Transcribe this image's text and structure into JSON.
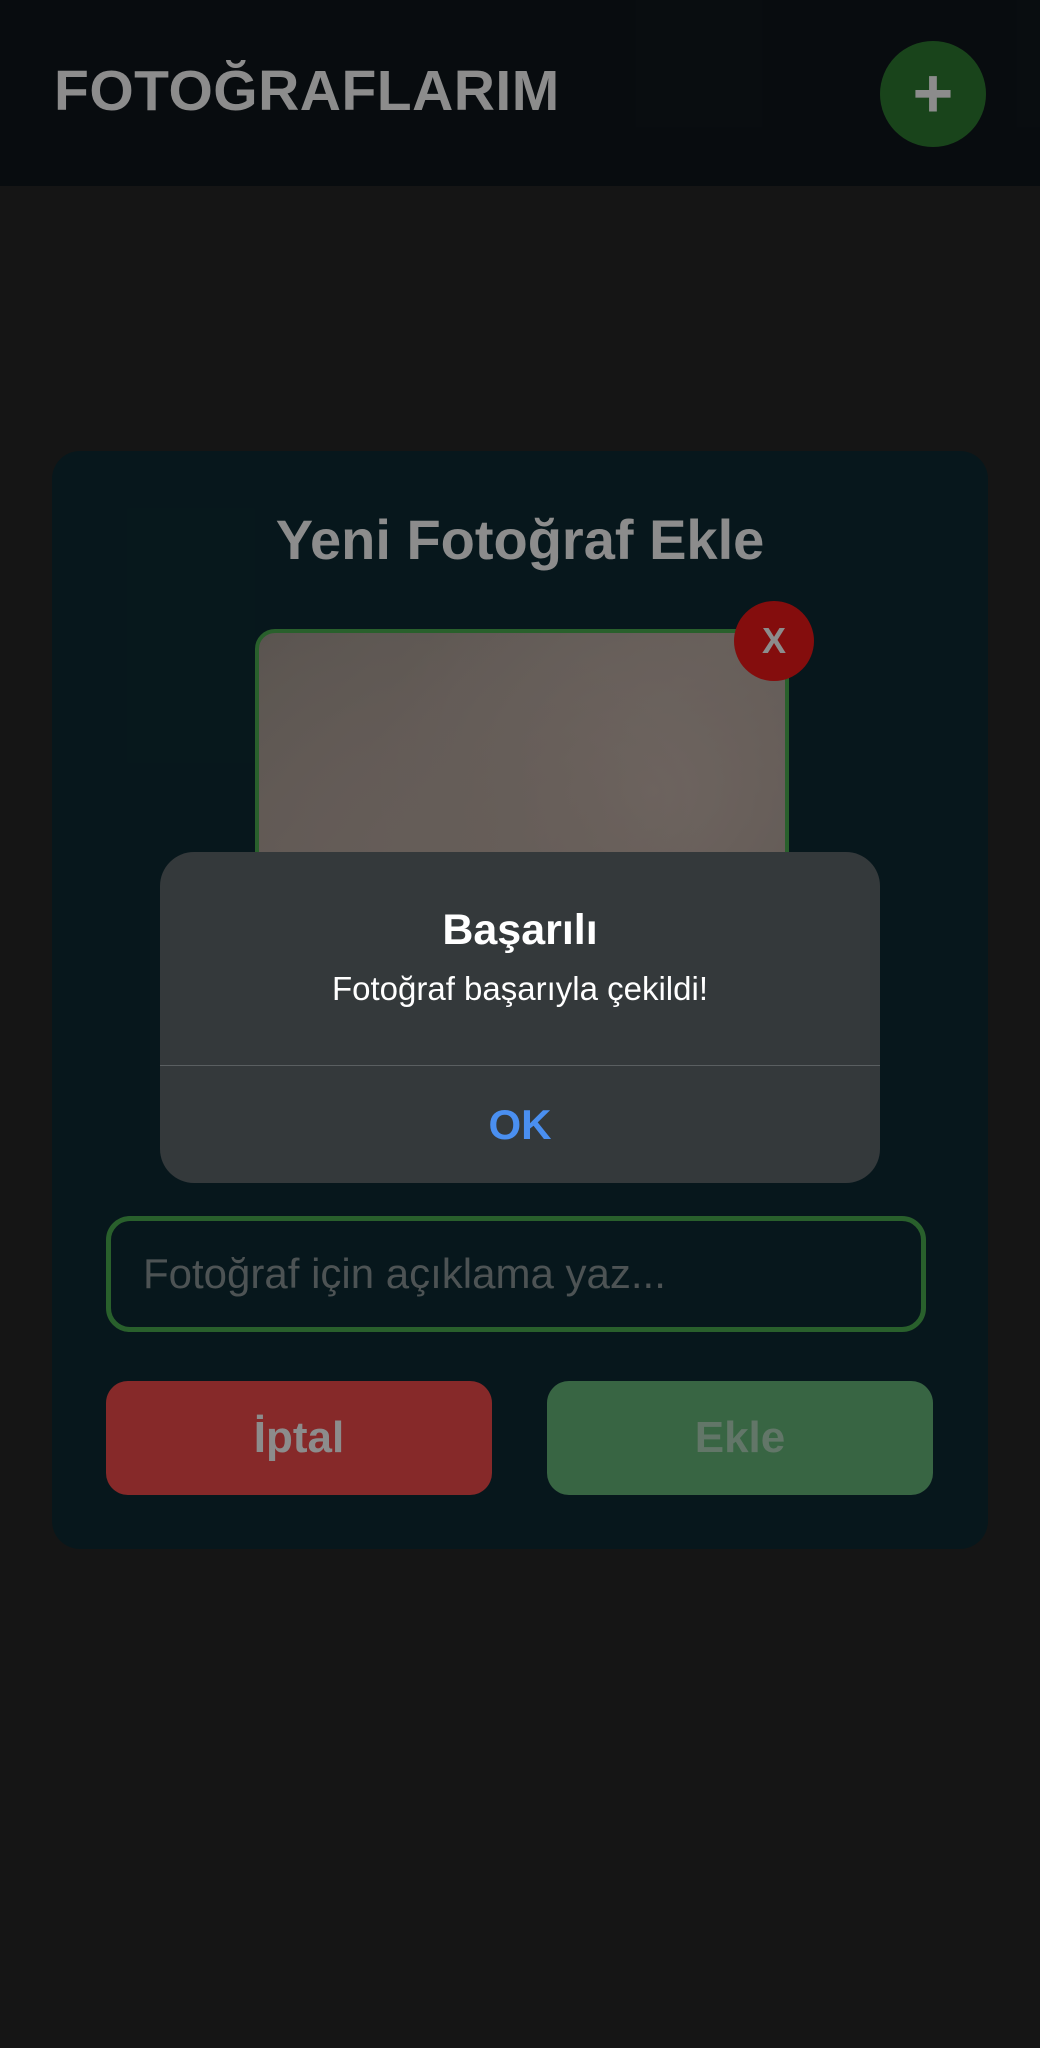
{
  "header": {
    "title": "FOTOĞRAFLARIM",
    "add_icon": "+"
  },
  "modal": {
    "title": "Yeni Fotoğraf Ekle",
    "remove_photo_label": "X",
    "description_placeholder": "Fotoğraf için açıklama yaz...",
    "description_value": "",
    "cancel_label": "İptal",
    "add_label": "Ekle"
  },
  "alert": {
    "title": "Başarılı",
    "message": "Fotoğraf başarıyla çekildi!",
    "ok_label": "OK"
  },
  "colors": {
    "header_bg": "#10171d",
    "modal_bg": "#0d2b33",
    "accent_green": "#4caf50",
    "cancel_red": "#f44b4b",
    "remove_red": "#f01818",
    "alert_link_blue": "#4a8ff0"
  }
}
